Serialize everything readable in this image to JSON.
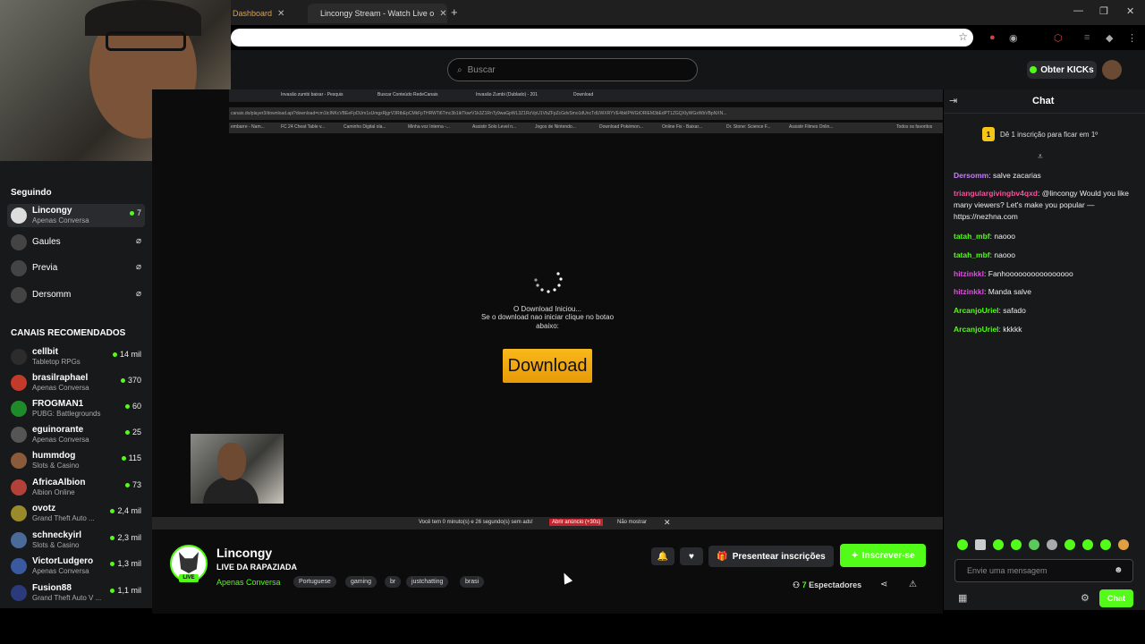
{
  "browser": {
    "tabs": [
      {
        "title": "Dashboard"
      },
      {
        "title": "Lincongy Stream - Watch Live o"
      }
    ],
    "new_tab_symbol": "+"
  },
  "kick_header": {
    "search_placeholder": "Buscar",
    "get_kicks_label": "Obter KICKs"
  },
  "sidebar": {
    "following_title": "Seguindo",
    "following": [
      {
        "name": "Lincongy",
        "sub": "Apenas Conversa",
        "count": "7",
        "live": true
      },
      {
        "name": "Gaules",
        "sub": "",
        "count": "",
        "live": false
      },
      {
        "name": "Previa",
        "sub": "",
        "count": "",
        "live": false
      },
      {
        "name": "Dersomm",
        "sub": "",
        "count": "",
        "live": false
      }
    ],
    "recommended_title": "CANAIS RECOMENDADOS",
    "recommended": [
      {
        "name": "cellbit",
        "sub": "Tabletop RPGs",
        "count": "14 mil"
      },
      {
        "name": "brasilraphael",
        "sub": "Apenas Conversa",
        "count": "370"
      },
      {
        "name": "FROGMAN1",
        "sub": "PUBG: Battlegrounds",
        "count": "60"
      },
      {
        "name": "eguinorante",
        "sub": "Apenas Conversa",
        "count": "25"
      },
      {
        "name": "hummdog",
        "sub": "Slots & Casino",
        "count": "115"
      },
      {
        "name": "AfricaAlbion",
        "sub": "Albion Online",
        "count": "73"
      },
      {
        "name": "ovotz",
        "sub": "Grand Theft Auto ...",
        "count": "2,4 mil"
      },
      {
        "name": "schneckyirl",
        "sub": "Slots & Casino",
        "count": "2,3 mil"
      },
      {
        "name": "VictorLudgero",
        "sub": "Apenas Conversa",
        "count": "1,3 mil"
      },
      {
        "name": "Fusion88",
        "sub": "Grand Theft Auto V ...",
        "count": "1,1 mil"
      }
    ]
  },
  "player": {
    "inner_tabs": [
      "Invasão zumbi baixar - Pesquis",
      "Buscar Conteúdo RedeCanais",
      "Invasão Zumbi (Dublado) - 201",
      "Download"
    ],
    "inner_url": "canais.do/player3/download.api?download=cm1tcINKcVBEeFpDUm1sUmgxRjgrV3RtbEpCMkFpTHRWTi6Tmc3b1ikTkwrV1k3Z1RnTy9waGpWL3Z1RzVpU1VbZFpZcGdvSmo1dUncTdUWXRYVE4bkIPWGtORlEM3bEdPT1ZGQXlyWGxWbVBpNXN...",
    "bookmarks": [
      "embarre - Nam...",
      "FC 24 Cheat Table v...",
      "Caminho Digital ola...",
      "Minha voz Interna -...",
      "Assistir Solo Level n...",
      "Jogos de Nintendo...",
      "Download Pokémon...",
      "Online Fix - Baixar...",
      "Dr. Stone: Science F...",
      "Assistir Filmes Onlin..."
    ],
    "bookmarks_all": "Todos os favoritos",
    "download_started": "O Download Iniciou...",
    "download_hint": "Se o download nao iniciar clique no botao abaixo:",
    "download_button": "Download",
    "ad_text": "Você tem 0 minuto(s) e 26 segundo(s) sem ads!",
    "ad_open": "Abrir anúncio (+30s)",
    "ad_hide": "Não mostrar"
  },
  "stream": {
    "channel": "Lincongy",
    "live_badge": "LIVE",
    "title": "LIVE DA RAPAZIADA",
    "category": "Apenas Conversa",
    "tags": [
      "Portuguese",
      "gaming",
      "br",
      "justchatting",
      "brasi"
    ],
    "gift_label": "Presentear inscrições",
    "subscribe_label": "Inscrever-se",
    "viewers_count": "7",
    "viewers_label": "Espectadores"
  },
  "chat": {
    "title": "Chat",
    "gift_rank_number": "1",
    "gift_rank_text": "Dê 1 inscrição para ficar em 1º",
    "messages": [
      {
        "user": "Dersomm",
        "color": "#c77dff",
        "text": "salve zacarias"
      },
      {
        "user": "triangulargivingbv4qxd",
        "color": "#ff4d9d",
        "text": "@lincongy Would you like many viewers? Let's make you popular — https://nezhna.com"
      },
      {
        "user": "tatah_mbf",
        "color": "#53fc18",
        "text": "naooo"
      },
      {
        "user": "tatah_mbf",
        "color": "#53fc18",
        "text": "naooo"
      },
      {
        "user": "hitzinkkl",
        "color": "#e04de0",
        "text": "Fanhoooooooooooooooo"
      },
      {
        "user": "hitzinkkl",
        "color": "#e04de0",
        "text": "Manda salve"
      },
      {
        "user": "ArcanjoUriel",
        "color": "#53fc18",
        "text": "safado"
      },
      {
        "user": "ArcanjoUriel",
        "color": "#53fc18",
        "text": "kkkkk"
      }
    ],
    "input_placeholder": "Envie uma mensagem",
    "send_label": "Chat"
  },
  "colors": {
    "accent": "#53fc18",
    "download": "#f5a90f",
    "background": "#0c0c0c"
  }
}
